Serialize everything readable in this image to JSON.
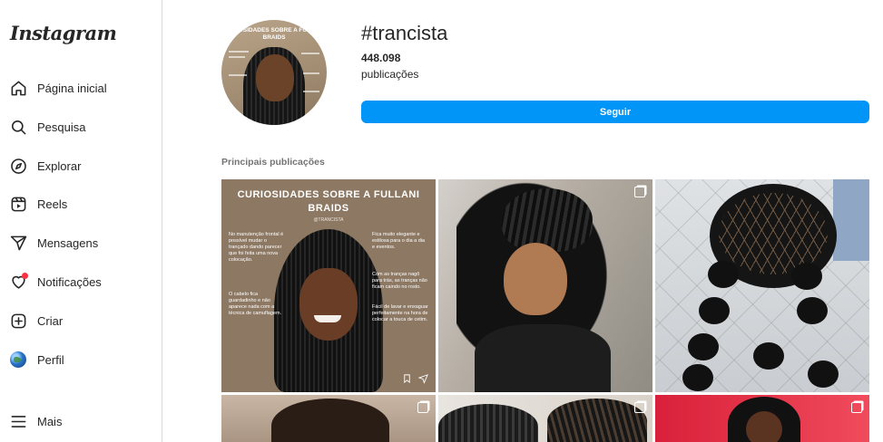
{
  "app": {
    "logo": "Instagram"
  },
  "sidebar": {
    "items": [
      {
        "label": "Página inicial",
        "icon": "home-icon"
      },
      {
        "label": "Pesquisa",
        "icon": "search-icon"
      },
      {
        "label": "Explorar",
        "icon": "compass-icon"
      },
      {
        "label": "Reels",
        "icon": "reels-icon"
      },
      {
        "label": "Mensagens",
        "icon": "send-icon"
      },
      {
        "label": "Notificações",
        "icon": "heart-icon"
      },
      {
        "label": "Criar",
        "icon": "plus-square-icon"
      },
      {
        "label": "Perfil",
        "icon": "profile-avatar"
      }
    ],
    "more": {
      "label": "Mais",
      "icon": "menu-icon"
    },
    "notification_dot_color": "#ff3040"
  },
  "header": {
    "avatar_title": "CURIOSIDADES SOBRE A FULLANI BRAIDS",
    "hashtag": "#trancista",
    "post_count": "448.098",
    "post_label": "publicações",
    "follow_label": "Seguir",
    "follow_color": "#0095f6"
  },
  "section": {
    "title": "Principais publicações"
  },
  "posts": {
    "first": {
      "title": "CURIOSIDADES SOBRE A FULLANI BRAIDS",
      "handle": "@TRANCISTA",
      "bullets": [
        "No manutenção frontal é possível mudar o trançado dando parecer que foi feita uma nova colocação.",
        "O cabelo fica guardadinho e não aparece nada com a técnica de camuflagem.",
        "Fica muito elegante e estilosa para o dia a dia e eventos.",
        "Com as tranças nagô para trás, as tranças não ficam caindo no rosto.",
        "Fácil de lavar e enxaguar perfeitamente na hora de colocar a touca de cetim."
      ]
    }
  }
}
